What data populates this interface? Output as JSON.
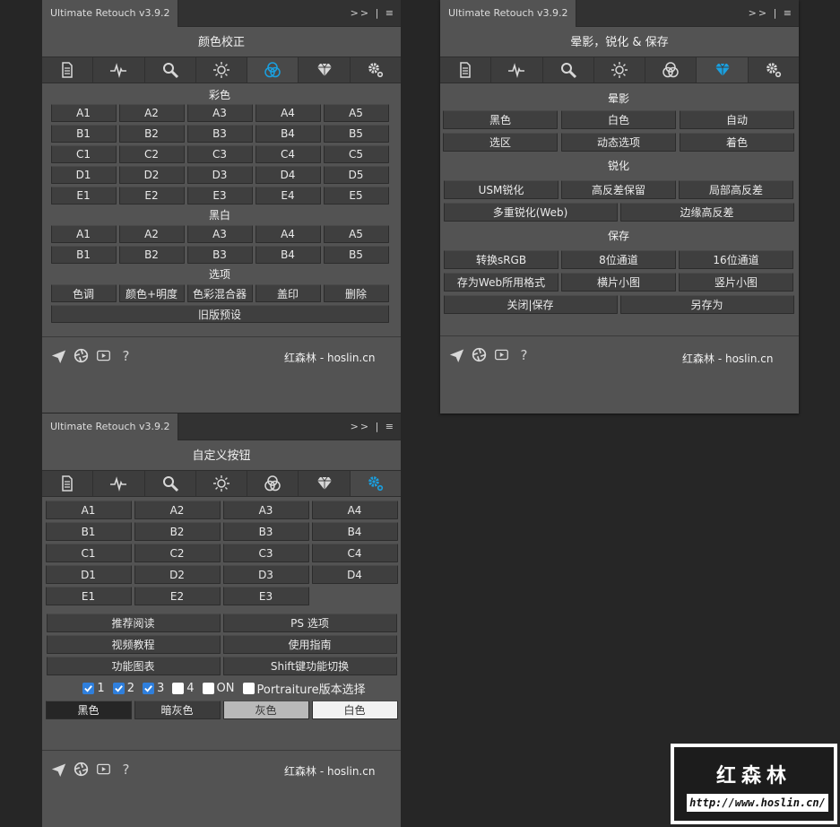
{
  "app_name": "Ultimate Retouch v3.9.2",
  "panel_controls": ">> | ≡",
  "credit": "红森林 - hoslin.cn",
  "accent": "#1aa0e0",
  "tab_icons": [
    "document-icon",
    "waveform-icon",
    "magnifier-icon",
    "sun-icon",
    "color-circles-icon",
    "diamond-icon",
    "gear-icon"
  ],
  "footer_icons": [
    "airplane-icon",
    "aperture-icon",
    "video-icon",
    "help-icon"
  ],
  "footer_help": "?",
  "panel1": {
    "title": "颜色校正",
    "active_tab": 4,
    "color_label": "彩色",
    "color_rows": [
      [
        "A1",
        "A2",
        "A3",
        "A4",
        "A5"
      ],
      [
        "B1",
        "B2",
        "B3",
        "B4",
        "B5"
      ],
      [
        "C1",
        "C2",
        "C3",
        "C4",
        "C5"
      ],
      [
        "D1",
        "D2",
        "D3",
        "D4",
        "D5"
      ],
      [
        "E1",
        "E2",
        "E3",
        "E4",
        "E5"
      ]
    ],
    "bw_label": "黑白",
    "bw_rows": [
      [
        "A1",
        "A2",
        "A3",
        "A4",
        "A5"
      ],
      [
        "B1",
        "B2",
        "B3",
        "B4",
        "B5"
      ]
    ],
    "opt_label": "选项",
    "opt_buttons": [
      "色调",
      "颜色+明度",
      "色彩混合器",
      "盖印",
      "删除"
    ],
    "legacy": "旧版预设"
  },
  "panel2": {
    "title": "晕影，锐化 & 保存",
    "active_tab": 5,
    "vignette_label": "晕影",
    "vignette_rows": [
      [
        "黑色",
        "白色",
        "自动"
      ],
      [
        "选区",
        "动态选项",
        "着色"
      ]
    ],
    "sharpen_label": "锐化",
    "sharpen_row1": [
      "USM锐化",
      "高反差保留",
      "局部高反差"
    ],
    "sharpen_row2": [
      "多重锐化(Web)",
      "边缘高反差"
    ],
    "save_label": "保存",
    "save_row1": [
      "转换sRGB",
      "8位通道",
      "16位通道"
    ],
    "save_row2": [
      "存为Web所用格式",
      "横片小图",
      "竖片小图"
    ],
    "save_row3": [
      "关闭|保存",
      "另存为"
    ]
  },
  "panel3": {
    "title": "自定义按钮",
    "active_tab": 6,
    "custom_rows": [
      [
        "A1",
        "A2",
        "A3",
        "A4"
      ],
      [
        "B1",
        "B2",
        "B3",
        "B4"
      ],
      [
        "C1",
        "C2",
        "C3",
        "C4"
      ],
      [
        "D1",
        "D2",
        "D3",
        "D4"
      ],
      [
        "E1",
        "E2",
        "E3"
      ]
    ],
    "link_rows": [
      [
        "推荐阅读",
        "PS 选项"
      ],
      [
        "视频教程",
        "使用指南"
      ],
      [
        "功能图表",
        "Shift键功能切换"
      ]
    ],
    "checkboxes": [
      {
        "label": "1",
        "checked": true
      },
      {
        "label": "2",
        "checked": true
      },
      {
        "label": "3",
        "checked": true
      },
      {
        "label": "4",
        "checked": false
      },
      {
        "label": "ON",
        "checked": false
      },
      {
        "label": "Portraiture版本选择",
        "checked": false
      }
    ],
    "bg_buttons": [
      {
        "label": "黑色",
        "bg": "#262626",
        "fg": "#eeeeee"
      },
      {
        "label": "暗灰色",
        "bg": "#3c3c3c",
        "fg": "#eeeeee"
      },
      {
        "label": "灰色",
        "bg": "#b9b9b9",
        "fg": "#333333"
      },
      {
        "label": "白色",
        "bg": "#f2f2f2",
        "fg": "#333333"
      }
    ]
  },
  "logo": {
    "title": "红森林",
    "url": "http://www.hoslin.cn/"
  }
}
